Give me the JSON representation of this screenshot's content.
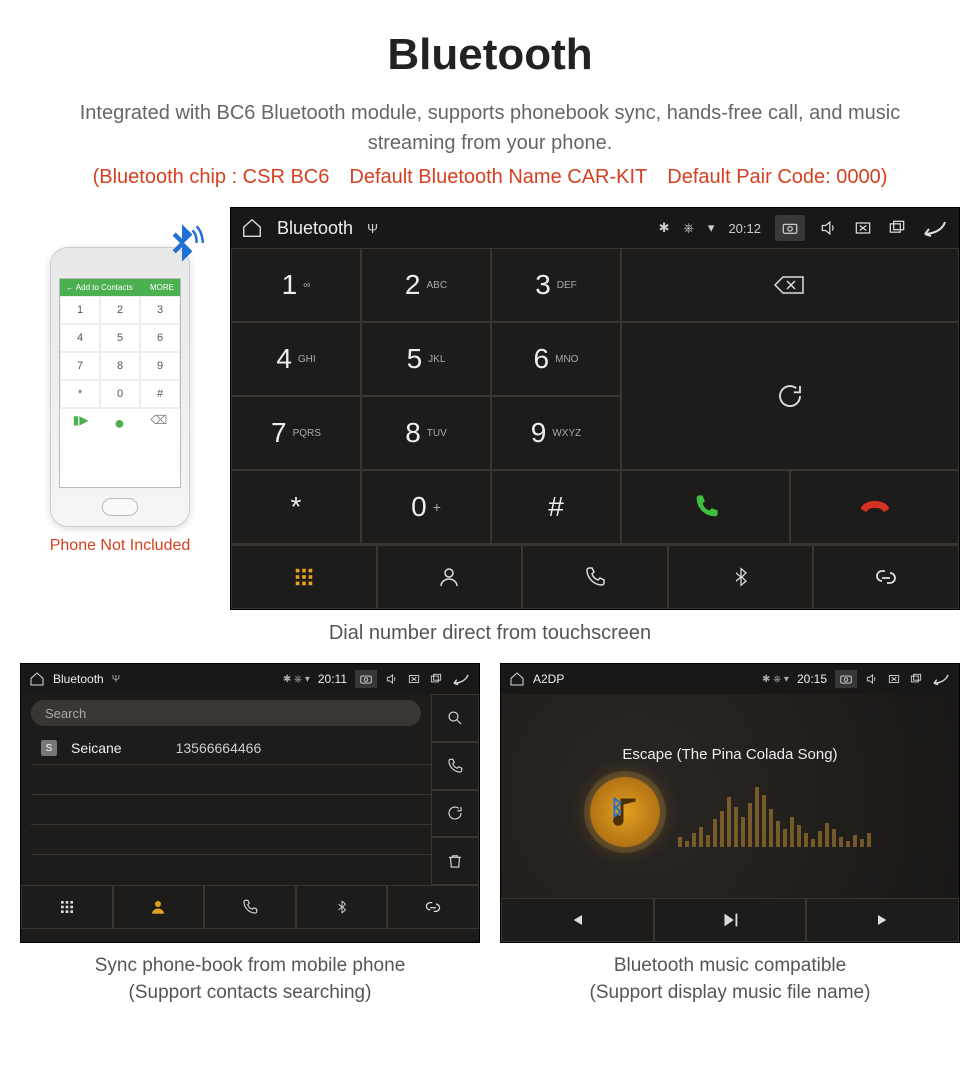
{
  "page": {
    "title": "Bluetooth",
    "subtitle": "Integrated with BC6 Bluetooth module, supports phonebook sync, hands-free call, and music streaming from your phone.",
    "specs": "(Bluetooth chip : CSR BC6 Default Bluetooth Name CAR-KIT Default Pair Code: 0000)"
  },
  "phone_mock": {
    "topbar_left": "←  Add to Contacts",
    "topbar_right": "MORE",
    "note": "Phone Not Included"
  },
  "dialer": {
    "statusbar": {
      "title": "Bluetooth",
      "time": "20:12"
    },
    "keys": [
      {
        "n": "1",
        "l": "∞"
      },
      {
        "n": "2",
        "l": "ABC"
      },
      {
        "n": "3",
        "l": "DEF"
      },
      {
        "n": "4",
        "l": "GHI"
      },
      {
        "n": "5",
        "l": "JKL"
      },
      {
        "n": "6",
        "l": "MNO"
      },
      {
        "n": "7",
        "l": "PQRS"
      },
      {
        "n": "8",
        "l": "TUV"
      },
      {
        "n": "9",
        "l": "WXYZ"
      },
      {
        "n": "*",
        "l": ""
      },
      {
        "n": "0",
        "l": "+"
      },
      {
        "n": "#",
        "l": ""
      }
    ],
    "caption": "Dial number direct from touchscreen"
  },
  "phonebook": {
    "statusbar": {
      "title": "Bluetooth",
      "time": "20:11"
    },
    "search_placeholder": "Search",
    "contact": {
      "badge": "S",
      "name": "Seicane",
      "number": "13566664466"
    },
    "caption_l1": "Sync phone-book from mobile phone",
    "caption_l2": "(Support contacts searching)"
  },
  "music": {
    "statusbar": {
      "title": "A2DP",
      "time": "20:15"
    },
    "song": "Escape (The Pina Colada Song)",
    "caption_l1": "Bluetooth music compatible",
    "caption_l2": "(Support display music file name)"
  }
}
